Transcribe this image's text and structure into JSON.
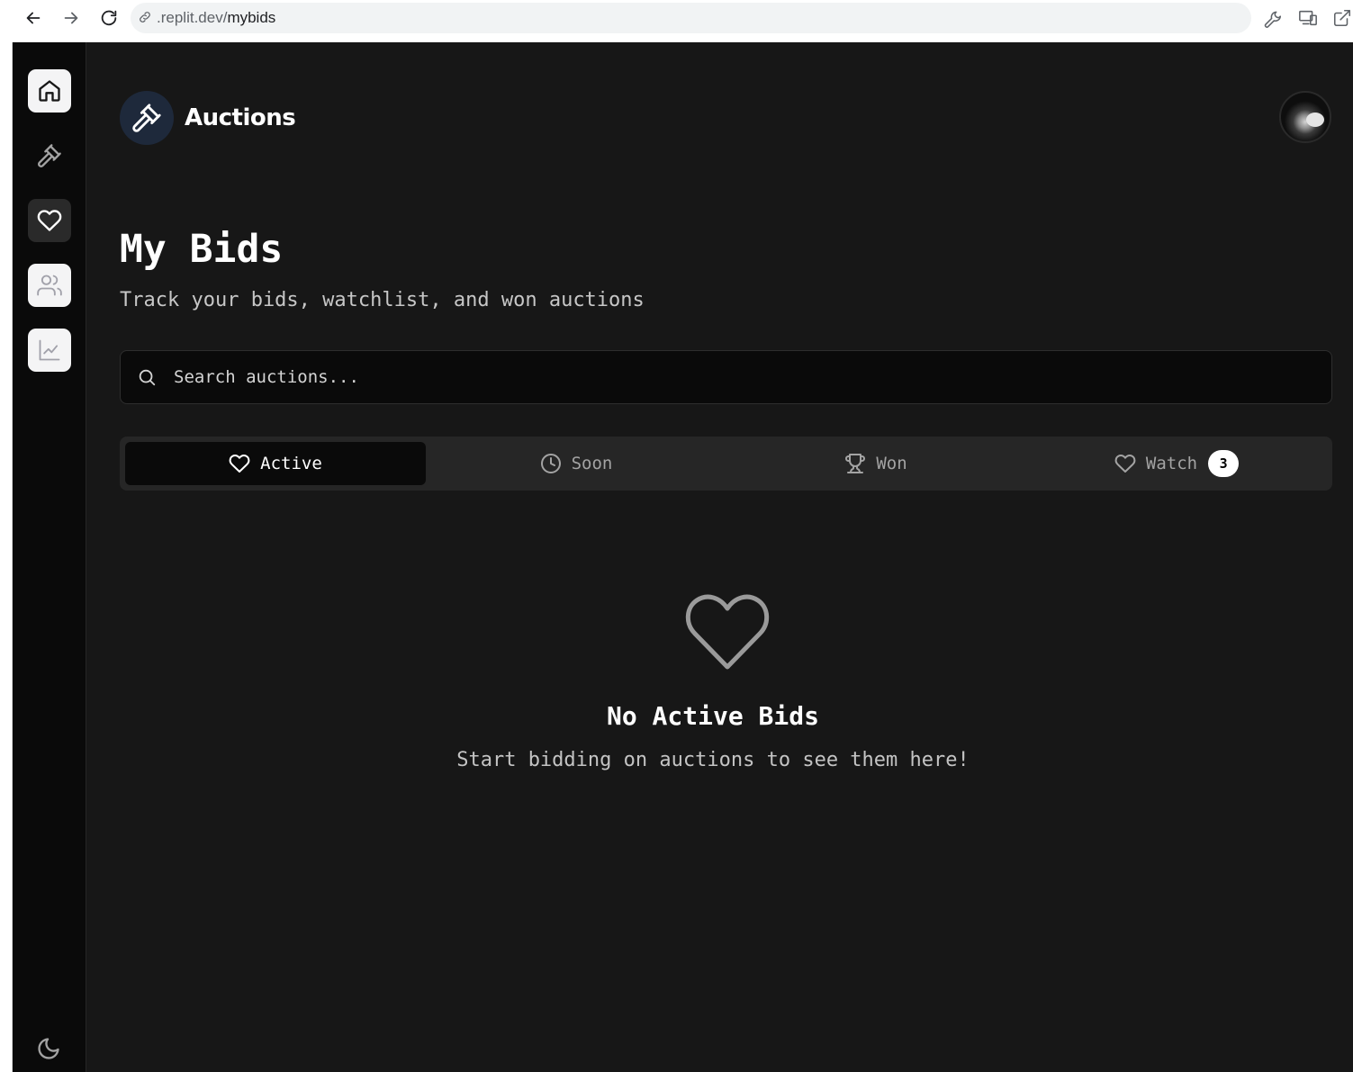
{
  "browser": {
    "url_host": ".replit.dev/",
    "url_path": "mybids"
  },
  "header": {
    "brand_name": "Auctions",
    "brand_icon": "gavel-icon"
  },
  "sidebar": {
    "items": [
      {
        "name": "home",
        "icon": "home-icon"
      },
      {
        "name": "auctions",
        "icon": "gavel-icon"
      },
      {
        "name": "my-bids",
        "icon": "heart-icon"
      },
      {
        "name": "users",
        "icon": "users-icon"
      },
      {
        "name": "analytics",
        "icon": "chart-icon"
      }
    ],
    "theme_icon": "moon-icon"
  },
  "page": {
    "title": "My Bids",
    "subtitle": "Track your bids, watchlist, and won auctions"
  },
  "search": {
    "placeholder": "Search auctions..."
  },
  "tabs": [
    {
      "label": "Active",
      "icon": "heart-icon",
      "selected": true
    },
    {
      "label": "Soon",
      "icon": "clock-icon",
      "selected": false
    },
    {
      "label": "Won",
      "icon": "trophy-icon",
      "selected": false
    },
    {
      "label": "Watch",
      "icon": "heart-icon",
      "selected": false,
      "count": "3"
    }
  ],
  "empty_state": {
    "icon": "heart-icon",
    "title": "No Active Bids",
    "message": "Start bidding on auctions to see them here!"
  },
  "colors": {
    "background": "#171717",
    "sidebar": "#0a0a0a",
    "accent": "#ffffff",
    "brand_badge": "#1e293b"
  }
}
